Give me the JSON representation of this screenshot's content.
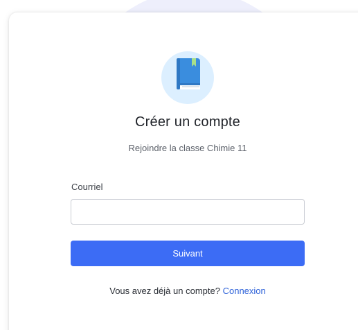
{
  "logo": {
    "icon": "book-icon",
    "circle_color": "#dcefff",
    "book_color": "#3a8dde",
    "bookmark_color": "#a8e08a"
  },
  "header": {
    "title": "Créer un compte",
    "subtitle": "Rejoindre la classe Chimie 11"
  },
  "form": {
    "email_label": "Courriel",
    "email_value": "",
    "email_placeholder": "",
    "next_label": "Suivant"
  },
  "footer": {
    "prompt": "Vous avez déjà un compte?",
    "login_link": "Connexion"
  },
  "colors": {
    "accent": "#3c6cf5",
    "link": "#2e62d9"
  }
}
